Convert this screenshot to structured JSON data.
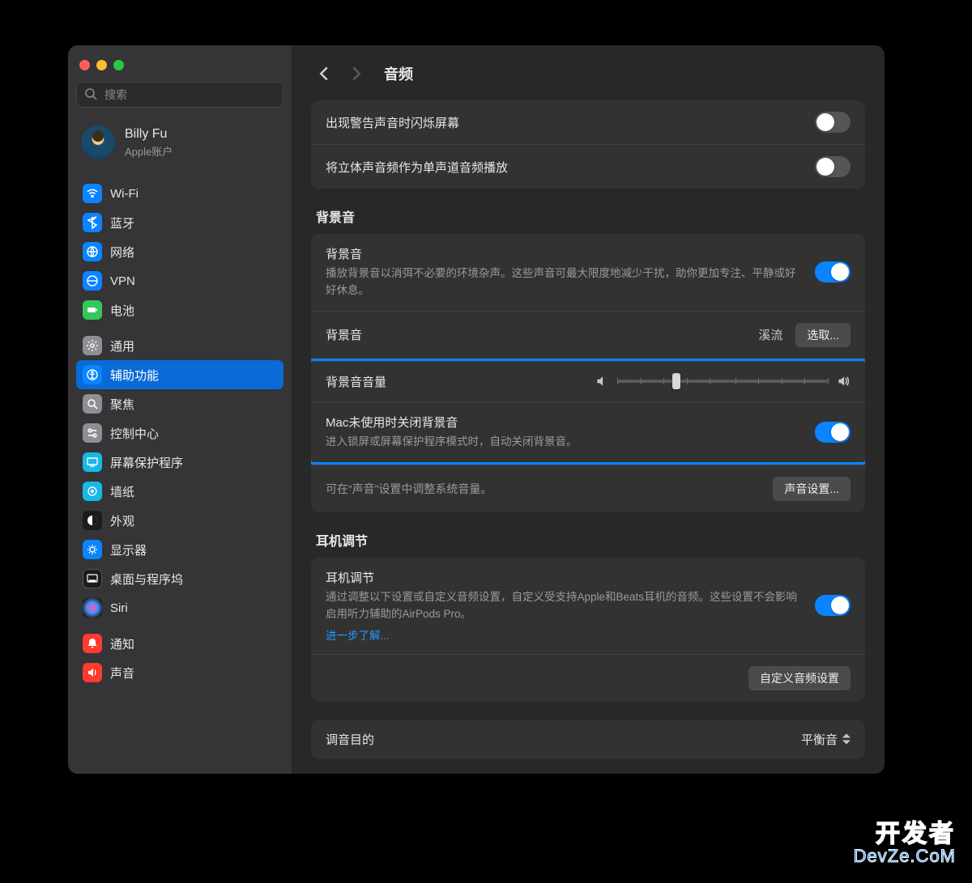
{
  "search": {
    "placeholder": "搜索"
  },
  "account": {
    "name": "Billy Fu",
    "sub": "Apple账户"
  },
  "sidebar": {
    "wifi": "Wi-Fi",
    "bluetooth": "蓝牙",
    "network": "网络",
    "vpn": "VPN",
    "battery": "电池",
    "general": "通用",
    "accessibility": "辅助功能",
    "spotlight": "聚焦",
    "control_center": "控制中心",
    "screensaver": "屏幕保护程序",
    "wallpaper": "墙纸",
    "appearance": "外观",
    "display": "显示器",
    "dock": "桌面与程序坞",
    "siri": "Siri",
    "notifications": "通知",
    "sound": "声音"
  },
  "header": {
    "title": "音频"
  },
  "group_alerts": {
    "flash_label": "出现警告声音时闪烁屏幕",
    "flash_on": false,
    "mono_label": "将立体声音频作为单声道音频播放",
    "mono_on": false
  },
  "group_bg": {
    "section": "背景音",
    "bg_title": "背景音",
    "bg_desc": "播放背景音以消弭不必要的环境杂声。这些声音可最大限度地减少干扰，助你更加专注、平静或好好休息。",
    "bg_on": true,
    "sound_row_label": "背景音",
    "sound_value": "溪流",
    "select_button": "选取...",
    "volume_label": "背景音音量",
    "volume_percent": 28,
    "mac_off_title": "Mac未使用时关闭背景音",
    "mac_off_desc": "进入锁屏或屏幕保护程序模式时，自动关闭背景音。",
    "mac_off_on": true,
    "hint": "可在“声音”设置中调整系统音量。",
    "sound_settings_btn": "声音设置..."
  },
  "group_hp": {
    "section": "耳机调节",
    "hp_title": "耳机调节",
    "hp_desc": "通过调整以下设置或自定义音频设置，自定义受支持Apple和Beats耳机的音频。这些设置不会影响启用听力辅助的AirPods Pro。",
    "hp_on": true,
    "learn_more": "进一步了解...",
    "custom_btn": "自定义音频设置"
  },
  "group_tuning": {
    "row_label": "调音目的",
    "value": "平衡音"
  },
  "watermark": {
    "l1": "开发者",
    "l2": "DevZe.CoM"
  }
}
